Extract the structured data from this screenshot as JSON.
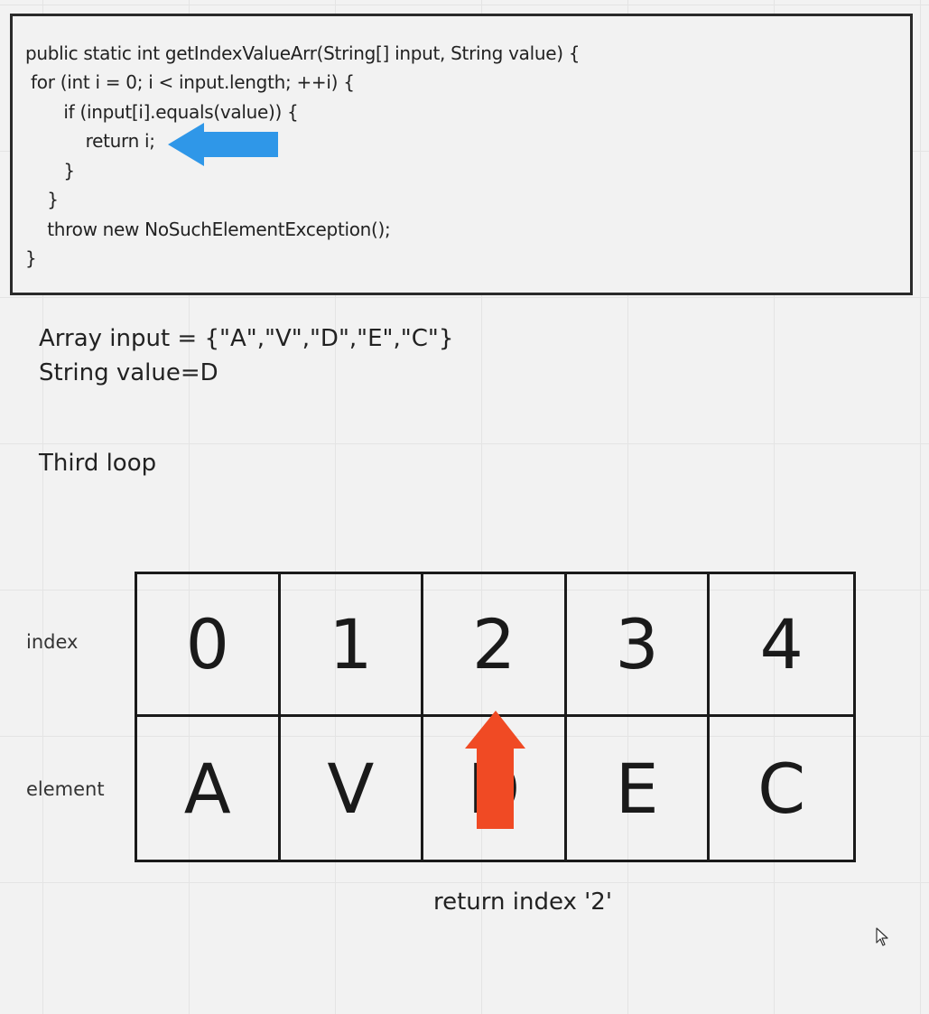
{
  "code": {
    "lines": [
      "public static int getIndexValueArr(String[] input, String value) {",
      " for (int i = 0; i < input.length; ++i) {",
      "       if (input[i].equals(value)) {",
      "           return i;",
      "       }",
      "    }",
      "    throw new NoSuchElementException();",
      "}"
    ]
  },
  "notes": {
    "array_line": "Array input = {\"A\",\"V\",\"D\",\"E\",\"C\"}",
    "value_line": "String value=D",
    "loop_line": "Third loop"
  },
  "table": {
    "row_labels": {
      "index": "index",
      "element": "element"
    },
    "indices": [
      "0",
      "1",
      "2",
      "3",
      "4"
    ],
    "elements": [
      "A",
      "V",
      "D",
      "E",
      "C"
    ]
  },
  "result": {
    "text": "return index '2'"
  },
  "colors": {
    "blue_arrow": "#2f97e8",
    "red_arrow": "#f04a24"
  },
  "icons": {
    "blue_arrow": "left-arrow-icon",
    "red_arrow": "up-arrow-icon",
    "cursor": "mouse-cursor-icon"
  }
}
